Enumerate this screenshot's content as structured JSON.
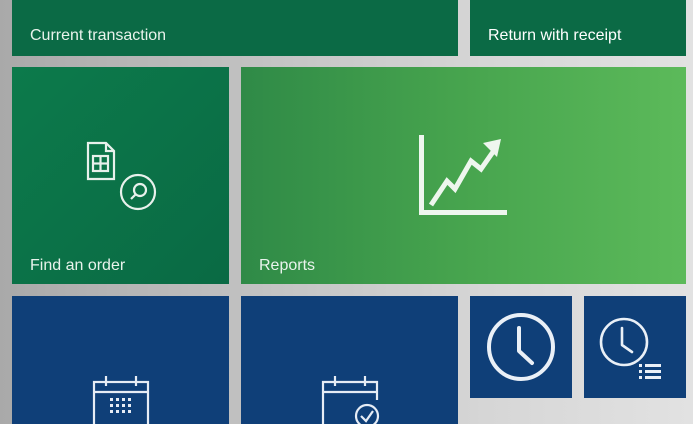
{
  "tiles": {
    "current_transaction": {
      "label": "Current transaction"
    },
    "return_with_receipt": {
      "label": "Return with receipt"
    },
    "find_an_order": {
      "label": "Find an order",
      "icon": "find-order-icon"
    },
    "reports": {
      "label": "Reports",
      "icon": "line-chart-icon"
    },
    "calendar_1": {
      "icon": "calendar-grid-icon"
    },
    "calendar_2": {
      "icon": "calendar-check-icon"
    },
    "clock": {
      "icon": "clock-icon"
    },
    "clock_list": {
      "icon": "clock-list-icon"
    }
  },
  "colors": {
    "dark_green": "#0b6a45",
    "green": "#0c7a4b",
    "light_green": "#5cba5a",
    "navy": "#0f3f78",
    "background": "#c4c4c4"
  }
}
